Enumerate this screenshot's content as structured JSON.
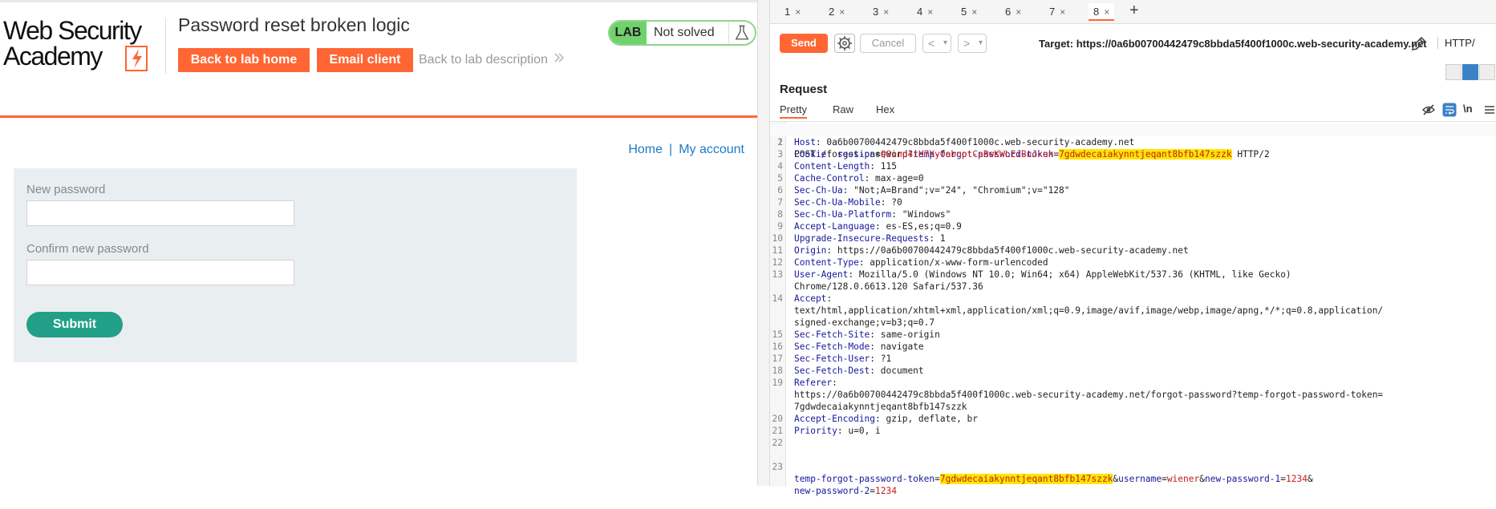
{
  "lab": {
    "logo_line1": "Web Security",
    "logo_line2": "Academy",
    "title": "Password reset broken logic",
    "back_home": "Back to lab home",
    "email_client": "Email client",
    "back_description": "Back to lab description",
    "status_tag": "LAB",
    "status_text": "Not solved",
    "nav_home": "Home",
    "nav_sep": "|",
    "nav_account": "My account",
    "form": {
      "new_password_label": "New password",
      "confirm_password_label": "Confirm new password",
      "submit": "Submit"
    }
  },
  "burp": {
    "tabs": [
      {
        "label": "1",
        "close": "×"
      },
      {
        "label": "2",
        "close": "×"
      },
      {
        "label": "3",
        "close": "×"
      },
      {
        "label": "4",
        "close": "×"
      },
      {
        "label": "5",
        "close": "×"
      },
      {
        "label": "6",
        "close": "×"
      },
      {
        "label": "7",
        "close": "×"
      },
      {
        "label": "8",
        "close": "×"
      }
    ],
    "tab_add": "+",
    "send": "Send",
    "cancel": "Cancel",
    "back_glyph": "<",
    "fwd_glyph": ">",
    "dropdown_glyph": "▾",
    "target": "Target: https://0a6b00700442479c8bbda5f400f1000c.web-security-academy.net",
    "http_version": "HTTP/",
    "request_title": "Request",
    "subtabs": [
      "Pretty",
      "Raw",
      "Hex"
    ],
    "ln_toggle": "\\n",
    "lines": [
      {
        "n": "1",
        "p1": "POST /forgot-password?",
        "k": "temp-forgot-password-token",
        "eq": "=",
        "hl": "7gdwdecaiakynntjeqant8bfb147szzk",
        "rest": " HTTP/2"
      },
      {
        "n": "2",
        "k": "Host",
        "v": ": 0a6b00700442479c8bbda5f400f1000c.web-security-academy.net"
      },
      {
        "n": "3",
        "k": "Cookie",
        "v": ": ",
        "k2": "session",
        "eq": "=",
        "v2": "Q8inp4iH7XyOabnptCaBwKWLEiBuJxuk"
      },
      {
        "n": "4",
        "k": "Content-Length",
        "v": ": 115"
      },
      {
        "n": "5",
        "k": "Cache-Control",
        "v": ": max-age=0"
      },
      {
        "n": "6",
        "k": "Sec-Ch-Ua",
        "v": ": \"Not;A=Brand\";v=\"24\", \"Chromium\";v=\"128\""
      },
      {
        "n": "7",
        "k": "Sec-Ch-Ua-Mobile",
        "v": ": ?0"
      },
      {
        "n": "8",
        "k": "Sec-Ch-Ua-Platform",
        "v": ": \"Windows\""
      },
      {
        "n": "9",
        "k": "Accept-Language",
        "v": ": es-ES,es;q=0.9"
      },
      {
        "n": "10",
        "k": "Upgrade-Insecure-Requests",
        "v": ": 1"
      },
      {
        "n": "11",
        "k": "Origin",
        "v": ": https://0a6b00700442479c8bbda5f400f1000c.web-security-academy.net"
      },
      {
        "n": "12",
        "k": "Content-Type",
        "v": ": application/x-www-form-urlencoded"
      },
      {
        "n": "13",
        "k": "User-Agent",
        "v": ": Mozilla/5.0 (Windows NT 10.0; Win64; x64) AppleWebKit/537.36 (KHTML, like Gecko)"
      },
      {
        "n": "",
        "v": "Chrome/128.0.6613.120 Safari/537.36"
      },
      {
        "n": "14",
        "k": "Accept",
        "v": ":"
      },
      {
        "n": "",
        "v": "text/html,application/xhtml+xml,application/xml;q=0.9,image/avif,image/webp,image/apng,*/*;q=0.8,application/"
      },
      {
        "n": "",
        "v": "signed-exchange;v=b3;q=0.7"
      },
      {
        "n": "15",
        "k": "Sec-Fetch-Site",
        "v": ": same-origin"
      },
      {
        "n": "16",
        "k": "Sec-Fetch-Mode",
        "v": ": navigate"
      },
      {
        "n": "17",
        "k": "Sec-Fetch-User",
        "v": ": ?1"
      },
      {
        "n": "18",
        "k": "Sec-Fetch-Dest",
        "v": ": document"
      },
      {
        "n": "19",
        "k": "Referer",
        "v": ":"
      },
      {
        "n": "",
        "v": "https://0a6b00700442479c8bbda5f400f1000c.web-security-academy.net/forgot-password?temp-forgot-password-token="
      },
      {
        "n": "",
        "v": "7gdwdecaiakynntjeqant8bfb147szzk"
      },
      {
        "n": "20",
        "k": "Accept-Encoding",
        "v": ": gzip, deflate, br"
      },
      {
        "n": "21",
        "k": "Priority",
        "v": ": u=0, i"
      },
      {
        "n": "22",
        "v": ""
      },
      {
        "n": "23",
        "k": "temp-forgot-password-token",
        "eq": "=",
        "hl": "7gdwdecaiakynntjeqant8bfb147szzk",
        "amp1": "&",
        "k2": "username",
        "eq2": "=",
        "v2": "wiener",
        "amp2": "&",
        "k3": "new-password-1",
        "eq3": "=",
        "v3": "1234",
        "amp3": "&"
      },
      {
        "n": "",
        "k": "new-password-2",
        "eq": "=",
        "v2": "1234"
      }
    ]
  },
  "colors": {
    "accent_orange": "#ff6633",
    "submit_green": "#22a087",
    "lab_status_green": "#70d16d",
    "highlight_yellow": "#ffe600",
    "header_key_blue": "#17179c",
    "header_value_red": "#c21d1d"
  }
}
